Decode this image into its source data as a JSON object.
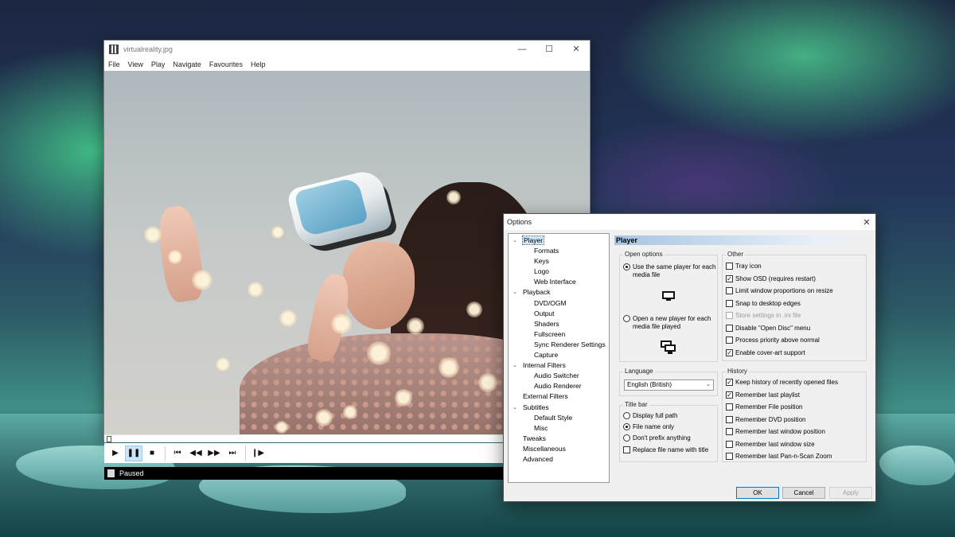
{
  "player": {
    "title": "virtualreality.jpg",
    "menu": [
      "File",
      "View",
      "Play",
      "Navigate",
      "Favourites",
      "Help"
    ],
    "status": "Paused",
    "window_buttons": {
      "minimize": "—",
      "maximize": "☐",
      "close": "✕"
    },
    "controls": {
      "play": "▶",
      "pause": "❚❚",
      "stop": "■",
      "prev": "⏮",
      "rewind": "◀◀",
      "forward": "▶▶",
      "next": "⏭",
      "frame_step": "❙▶"
    }
  },
  "options": {
    "title": "Options",
    "close": "✕",
    "tree": [
      {
        "label": "Player",
        "level": 0,
        "expander": "⌄",
        "selected": true
      },
      {
        "label": "Formats",
        "level": 1
      },
      {
        "label": "Keys",
        "level": 1
      },
      {
        "label": "Logo",
        "level": 1
      },
      {
        "label": "Web Interface",
        "level": 1
      },
      {
        "label": "Playback",
        "level": 0,
        "expander": "⌄"
      },
      {
        "label": "DVD/OGM",
        "level": 1
      },
      {
        "label": "Output",
        "level": 1
      },
      {
        "label": "Shaders",
        "level": 1
      },
      {
        "label": "Fullscreen",
        "level": 1
      },
      {
        "label": "Sync Renderer Settings",
        "level": 1
      },
      {
        "label": "Capture",
        "level": 1
      },
      {
        "label": "Internal Filters",
        "level": 0,
        "expander": "⌄"
      },
      {
        "label": "Audio Switcher",
        "level": 1
      },
      {
        "label": "Audio Renderer",
        "level": 1
      },
      {
        "label": "External Filters",
        "level": 0
      },
      {
        "label": "Subtitles",
        "level": 0,
        "expander": "⌄"
      },
      {
        "label": "Default Style",
        "level": 1
      },
      {
        "label": "Misc",
        "level": 1
      },
      {
        "label": "Tweaks",
        "level": 0
      },
      {
        "label": "Miscellaneous",
        "level": 0
      },
      {
        "label": "Advanced",
        "level": 0
      }
    ],
    "page_title": "Player",
    "open_options": {
      "label": "Open options",
      "same_player": "Use the same player for each media file",
      "new_player": "Open a new player for each media file played"
    },
    "language": {
      "label": "Language",
      "value": "English (British)",
      "arrow": "⌄"
    },
    "title_bar": {
      "label": "Title bar",
      "full_path": "Display full path",
      "file_name_only": "File name only",
      "no_prefix": "Don't prefix anything",
      "replace_with_title": "Replace file name with title"
    },
    "other": {
      "label": "Other",
      "items": [
        {
          "label": "Tray icon",
          "checked": false
        },
        {
          "label": "Show OSD (requires restart)",
          "checked": true
        },
        {
          "label": "Limit window proportions on resize",
          "checked": false
        },
        {
          "label": "Snap to desktop edges",
          "checked": false
        },
        {
          "label": "Store settings in .ini file",
          "checked": false,
          "disabled": true
        },
        {
          "label": "Disable \"Open Disc\" menu",
          "checked": false
        },
        {
          "label": "Process priority above normal",
          "checked": false
        },
        {
          "label": "Enable cover-art support",
          "checked": true
        }
      ]
    },
    "history": {
      "label": "History",
      "items": [
        {
          "label": "Keep history of recently opened files",
          "checked": true
        },
        {
          "label": "Remember last playlist",
          "checked": true
        },
        {
          "label": "Remember File position",
          "checked": false
        },
        {
          "label": "Remember DVD position",
          "checked": false
        },
        {
          "label": "Remember last window position",
          "checked": false
        },
        {
          "label": "Remember last window size",
          "checked": false
        },
        {
          "label": "Remember last Pan-n-Scan Zoom",
          "checked": false
        }
      ]
    },
    "buttons": {
      "ok": "OK",
      "cancel": "Cancel",
      "apply": "Apply"
    },
    "check_mark": "✓"
  }
}
